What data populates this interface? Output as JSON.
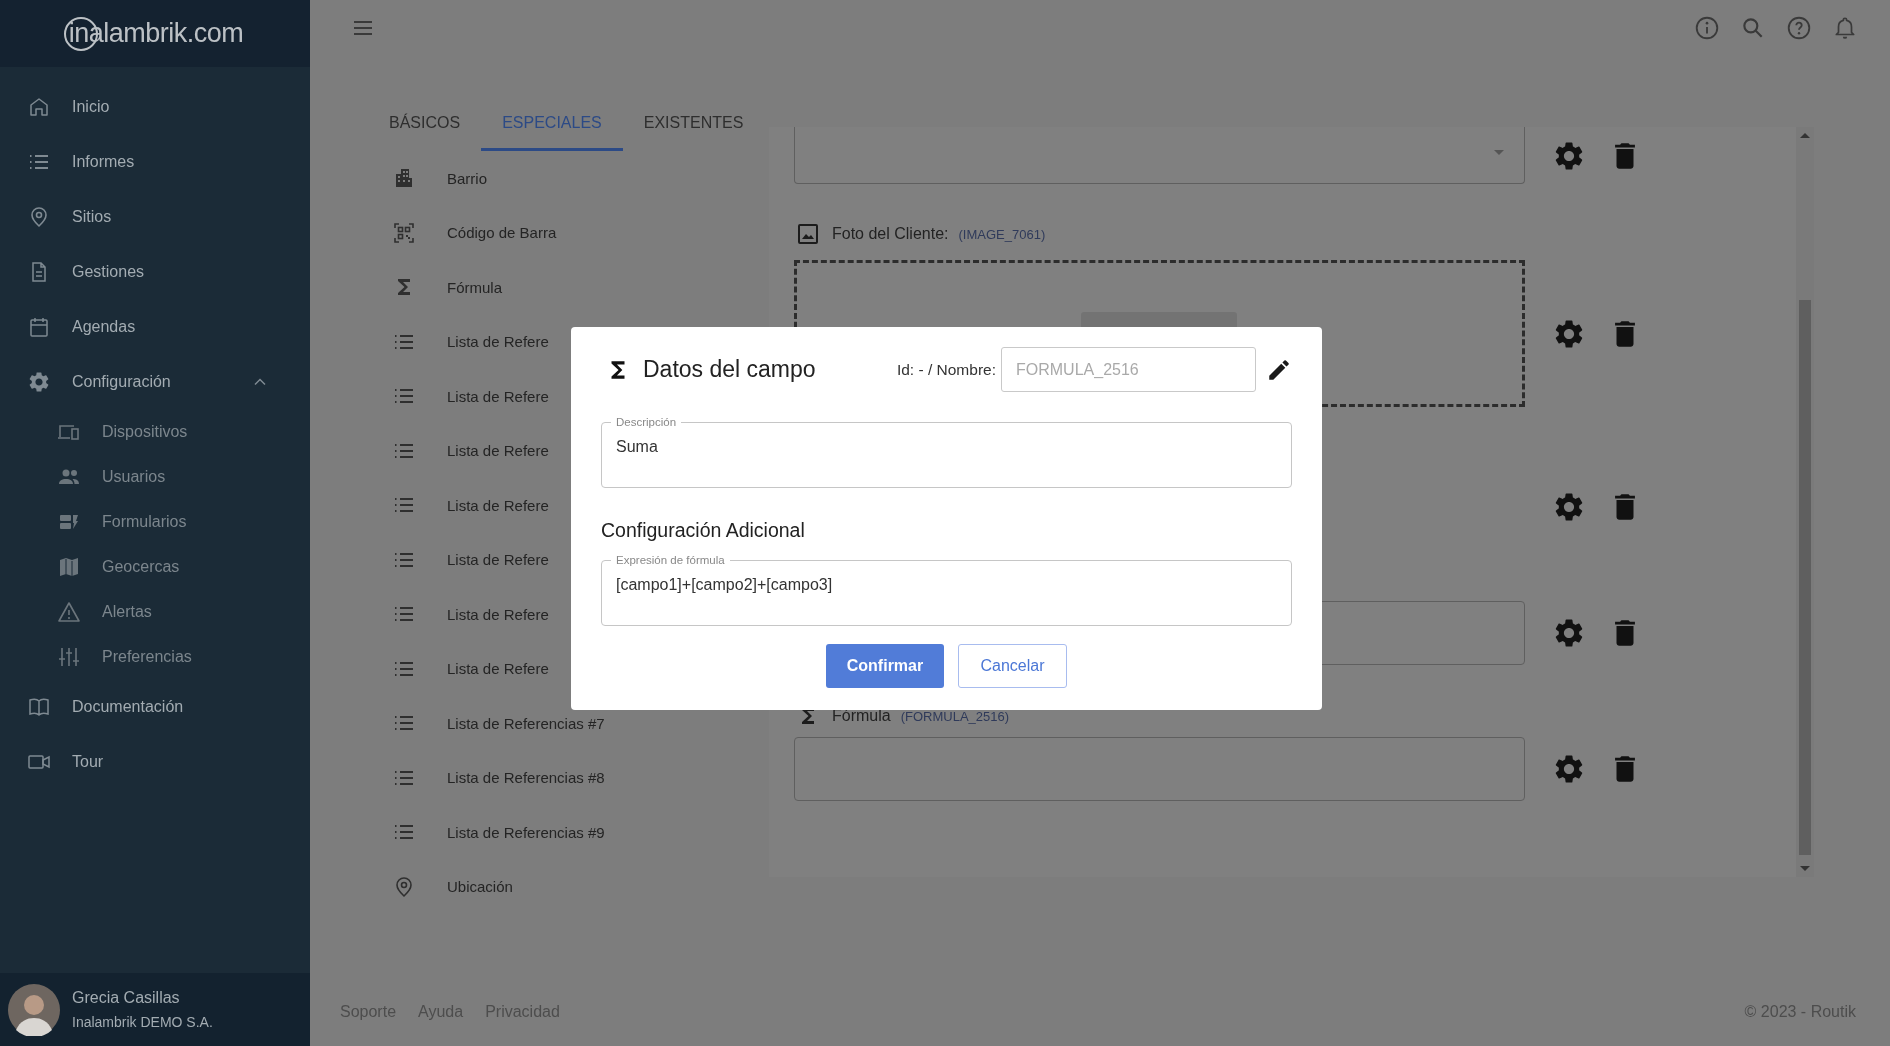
{
  "sidebar": {
    "logo": "inalambrik.com",
    "items": [
      {
        "label": "Inicio"
      },
      {
        "label": "Informes"
      },
      {
        "label": "Sitios"
      },
      {
        "label": "Gestiones"
      },
      {
        "label": "Agendas"
      },
      {
        "label": "Configuración",
        "expanded": true,
        "children": [
          {
            "label": "Dispositivos"
          },
          {
            "label": "Usuarios"
          },
          {
            "label": "Formularios"
          },
          {
            "label": "Geocercas"
          },
          {
            "label": "Alertas"
          },
          {
            "label": "Preferencias"
          }
        ]
      },
      {
        "label": "Documentación"
      },
      {
        "label": "Tour"
      }
    ],
    "user": {
      "name": "Grecia Casillas",
      "company": "Inalambrik DEMO S.A."
    }
  },
  "tabs": [
    {
      "label": "BÁSICOS",
      "selected": false
    },
    {
      "label": "ESPECIALES",
      "selected": true
    },
    {
      "label": "EXISTENTES",
      "selected": false
    }
  ],
  "field_types": [
    "Barrio",
    "Código de Barra",
    "Fórmula",
    "Lista de Refere",
    "Lista de Refere",
    "Lista de Refere",
    "Lista de Refere",
    "Lista de Refere",
    "Lista de Refere",
    "Lista de Refere",
    "Lista de Referencias #7",
    "Lista de Referencias #8",
    "Lista de Referencias #9",
    "Ubicación"
  ],
  "form_rows": [
    {
      "kind": "select"
    },
    {
      "kind": "image",
      "label": "Foto del Cliente:",
      "code": "(IMAGE_7061)"
    },
    {
      "kind": "covered"
    },
    {
      "kind": "input"
    },
    {
      "kind": "labeled_input",
      "label": "Fórmula",
      "code": "(FORMULA_2516)"
    }
  ],
  "modal": {
    "title": "Datos del campo",
    "id_label": "Id: - / Nombre:",
    "name_value": "FORMULA_2516",
    "name_disabled": true,
    "description": {
      "label": "Descripción",
      "value": "Suma"
    },
    "section": "Configuración Adicional",
    "formula": {
      "label": "Expresión de fórmula",
      "value": "[campo1]+[campo2]+[campo3]"
    },
    "buttons": [
      {
        "label": "Confirmar",
        "kind": "primary"
      },
      {
        "label": "Cancelar",
        "kind": "secondary"
      }
    ]
  },
  "footer": {
    "links": [
      "Soporte",
      "Ayuda",
      "Privacidad"
    ],
    "copyright": "© 2023 - Routik"
  }
}
